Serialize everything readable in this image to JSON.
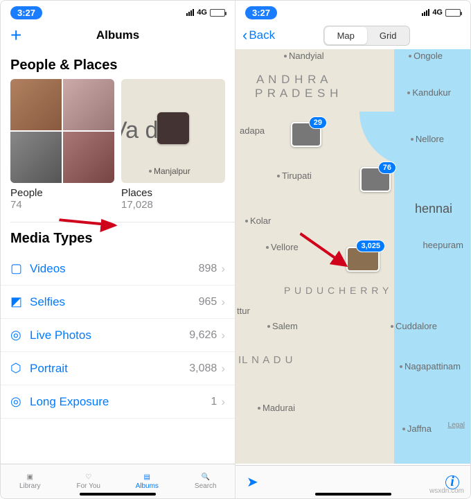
{
  "status": {
    "time": "3:27",
    "network": "4G"
  },
  "left": {
    "nav_title": "Albums",
    "sections": {
      "people_places_title": "People & Places",
      "people_label": "People",
      "people_count": "74",
      "places_label": "Places",
      "places_count": "17,028",
      "places_city_big": "Va        da",
      "places_city_small": "Manjalpur",
      "media_types_title": "Media Types"
    },
    "media_types": [
      {
        "icon": "▢",
        "label": "Videos",
        "count": "898"
      },
      {
        "icon": "◩",
        "label": "Selfies",
        "count": "965"
      },
      {
        "icon": "◎",
        "label": "Live Photos",
        "count": "9,626"
      },
      {
        "icon": "⬡",
        "label": "Portrait",
        "count": "3,088"
      },
      {
        "icon": "◎",
        "label": "Long Exposure",
        "count": "1"
      }
    ],
    "tabs": [
      {
        "label": "Library"
      },
      {
        "label": "For You"
      },
      {
        "label": "Albums"
      },
      {
        "label": "Search"
      }
    ]
  },
  "right": {
    "back_label": "Back",
    "seg_map": "Map",
    "seg_grid": "Grid",
    "legal": "Legal",
    "cities": {
      "nandyial": "Nandyial",
      "ongole": "Ongole",
      "andhra": "A N D H R A",
      "pradesh": "P R A D E S H",
      "kandukur": "Kandukur",
      "adapa": "adapa",
      "nellore": "Nellore",
      "tirupati": "Tirupati",
      "chennai": "hennai",
      "kolar": "Kolar",
      "vellore": "Vellore",
      "heepuram": "heepuram",
      "puducherry": "P U D U C H E R R Y",
      "ttur": "ttur",
      "salem": "Salem",
      "cuddalore": "Cuddalore",
      "ilnadu": "IL  N A D U",
      "nagapattinam": "Nagapattinam",
      "madurai": "Madurai",
      "jaffna": "Jaffna"
    },
    "clusters": [
      {
        "count": "29"
      },
      {
        "count": "76"
      },
      {
        "count": "3,025"
      }
    ]
  },
  "watermark": "wsxdn.com"
}
